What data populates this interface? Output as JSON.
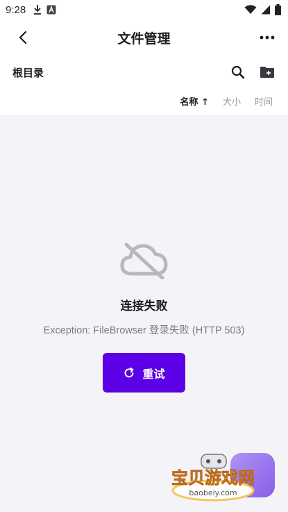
{
  "status_bar": {
    "time": "9:28"
  },
  "app_bar": {
    "title": "文件管理"
  },
  "path_bar": {
    "breadcrumb": "根目录"
  },
  "sort_bar": {
    "options": [
      {
        "label": "名称 ↑",
        "active": true
      },
      {
        "label": "大小",
        "active": false
      },
      {
        "label": "时间",
        "active": false
      }
    ]
  },
  "empty_state": {
    "title": "连接失败",
    "message": "Exception: FileBrowser 登录失败 (HTTP 503)",
    "retry_label": "重试"
  },
  "watermark": {
    "brand": "宝贝游戏网",
    "domain": "baobeiy.com"
  },
  "colors": {
    "accent": "#5c00e6",
    "background": "#f4f3f8",
    "surface": "#ffffff",
    "muted_text": "#7c7a84",
    "icon_gray": "#b8b6bf"
  },
  "icons": {
    "status": [
      "download-icon",
      "a-icon",
      "wifi-icon",
      "signal-icon",
      "battery-icon"
    ],
    "app_bar": [
      "back-arrow-icon",
      "more-vert-icon"
    ],
    "path_bar": [
      "search-icon",
      "new-folder-icon"
    ],
    "empty_state": [
      "cloud-off-icon",
      "refresh-icon"
    ]
  }
}
